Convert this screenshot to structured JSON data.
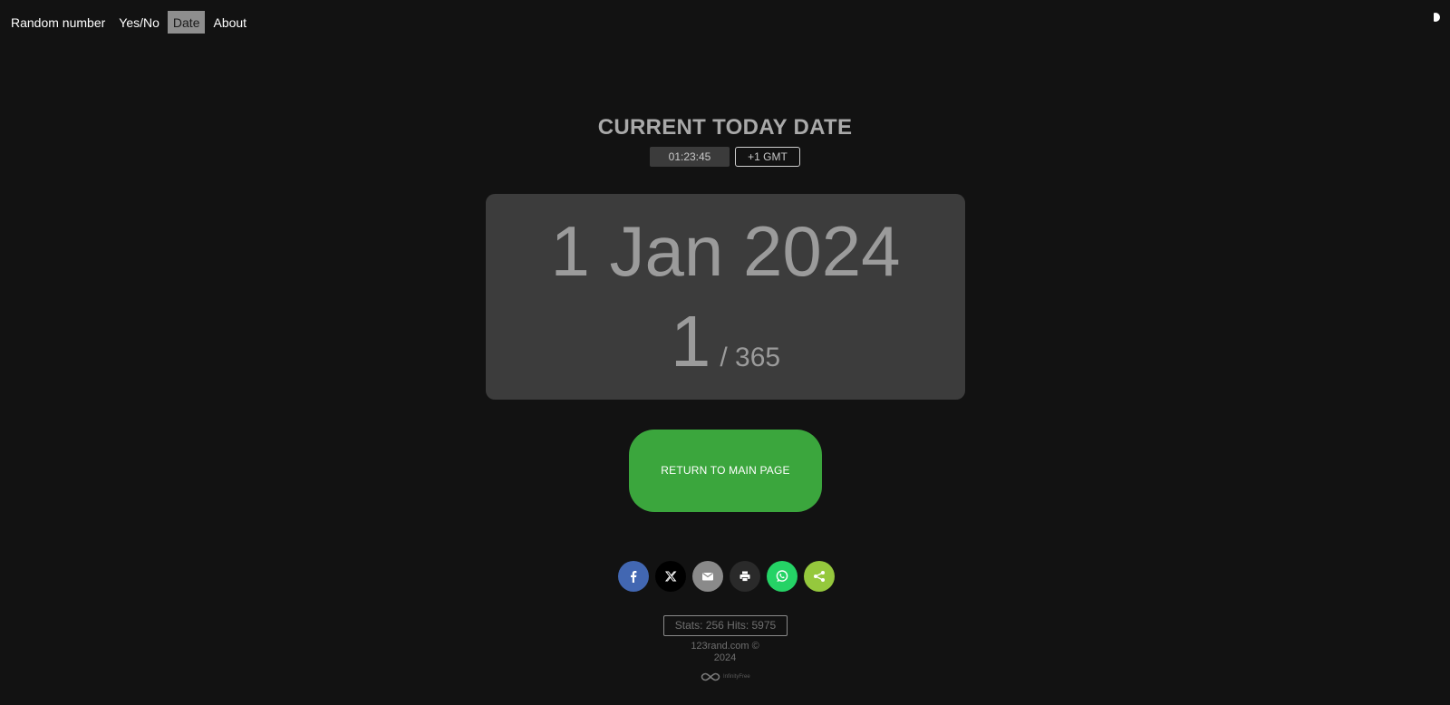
{
  "nav": {
    "items": [
      {
        "label": "Random number",
        "active": false
      },
      {
        "label": "Yes/No",
        "active": false
      },
      {
        "label": "Date",
        "active": true
      },
      {
        "label": "About",
        "active": false
      }
    ]
  },
  "theme_toggle_icon": "half-moon-icon",
  "header": {
    "title": "CURRENT TODAY DATE",
    "time": "01:23:45",
    "timezone": "+1 GMT"
  },
  "date_card": {
    "date": "1 Jan 2024",
    "day_of_year": "1",
    "days_total": "/ 365"
  },
  "return_button": {
    "label": "RETURN TO MAIN PAGE",
    "color": "#3ba63d"
  },
  "share": {
    "buttons": [
      {
        "name": "facebook-icon",
        "color": "#4267b2"
      },
      {
        "name": "x-icon",
        "color": "#000000"
      },
      {
        "name": "email-icon",
        "color": "#8a8a8a"
      },
      {
        "name": "print-icon",
        "color": "#2a2a2a"
      },
      {
        "name": "whatsapp-icon",
        "color": "#25d366"
      },
      {
        "name": "share-icon",
        "color": "#95c83d"
      }
    ]
  },
  "footer": {
    "stats": "Stats: 256 Hits: 5975",
    "copyright_line1": "123rand.com ©",
    "copyright_line2": "2024",
    "logo_text": "InfinityFree"
  }
}
